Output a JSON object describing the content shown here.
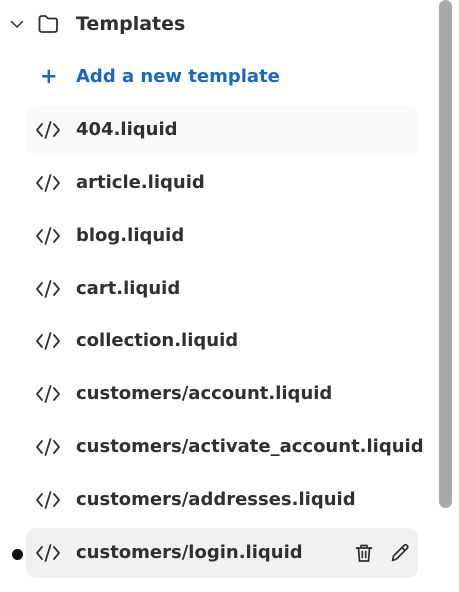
{
  "folder": {
    "label": "Templates",
    "expanded": true,
    "icons": {
      "toggle": "chevron-down-icon",
      "folder": "folder-icon"
    }
  },
  "add_template": {
    "icon": "+",
    "label": "Add a new template",
    "color": "#1a66c9"
  },
  "files": [
    {
      "label": "404.liquid",
      "state": "hover"
    },
    {
      "label": "article.liquid",
      "state": "normal"
    },
    {
      "label": "blog.liquid",
      "state": "normal"
    },
    {
      "label": "cart.liquid",
      "state": "normal"
    },
    {
      "label": "collection.liquid",
      "state": "normal"
    },
    {
      "label": "customers/account.liquid",
      "state": "normal"
    },
    {
      "label": "customers/activate_account.liquid",
      "state": "normal"
    },
    {
      "label": "customers/addresses.liquid",
      "state": "normal"
    },
    {
      "label": "customers/login.liquid",
      "state": "active",
      "unsaved": true,
      "actions": [
        "delete-icon",
        "edit-icon"
      ]
    }
  ],
  "icons": {
    "file": "code-icon"
  },
  "colors": {
    "text": "#303030",
    "hover_row": "#fafafa",
    "active_row": "#f1f1f1",
    "scroll_thumb": "#a9a9a9"
  }
}
